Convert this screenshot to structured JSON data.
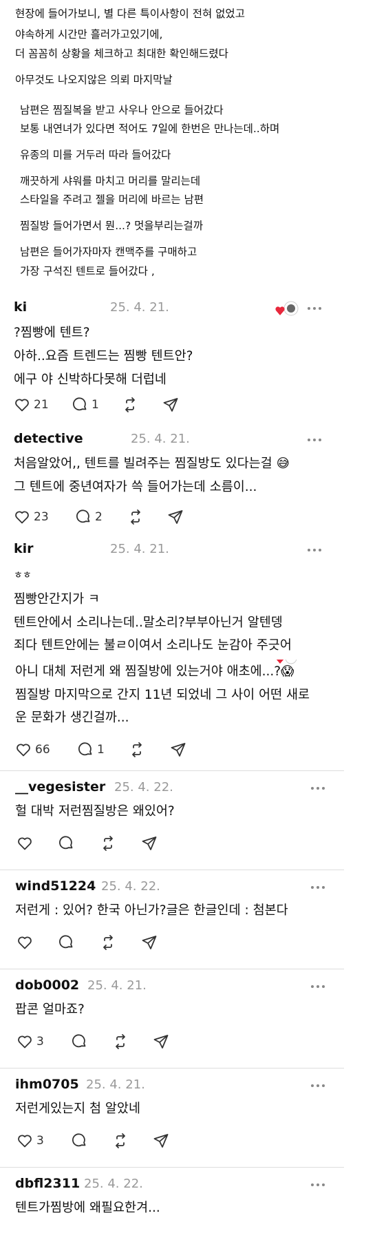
{
  "post": {
    "paragraphs": [
      [
        "현장에 들어가보니, 별 다른 특이사항이 전혀 없었고",
        "야속하게 시간만 흘러가고있기에,",
        "더 꼼꼼히 상황을 체크하고 최대한 확인해드렸다"
      ],
      [
        "아무것도 나오지않은 의뢰 마지막날"
      ],
      [
        "남편은 찜질복을 받고 사우나 안으로 들어갔다",
        "보통 내연녀가 있다면 적어도 7일에 한번은 만나는데..하며"
      ],
      [
        "유종의 미를 거두러 따라 들어갔다"
      ],
      [
        "깨끗하게 샤워를 마치고 머리를 말리는데",
        "스타일을 주려고 젤을 머리에 바르는 남편"
      ],
      [
        "찜질방 들어가면서 뭔...? 멋을부리는걸까"
      ],
      [
        "남편은 들어가자마자 캔맥주를 구매하고",
        "가장 구석진 텐트로 들어갔다 ,"
      ]
    ]
  },
  "replies": [
    {
      "username": "ki",
      "date": "25. 4. 21.",
      "lines": [
        "?찜빵에 텐트?",
        "아하..요즘 트렌드는 찜빵 텐트안?",
        "에구 야 신박하다못해 더럽네"
      ],
      "likes": "21",
      "comments": "1"
    },
    {
      "username": "detective",
      "date": "25. 4. 21.",
      "lines": [
        "처음알았어,, 텐트를 빌려주는 찜질방도 있다는걸 😅",
        "그 텐트에 중년여자가 쓱 들어가는데 소름이..."
      ],
      "likes": "23",
      "comments": "2"
    },
    {
      "username": "kir",
      "date": "25. 4. 21.",
      "lines": [
        "ㅎㅎ",
        "찜빵안간지가 ㅋ",
        "텐트안에서 소리나는데..말소리?부부아닌거 알텐뎅",
        "죄다 텐트안에는 불ㄹ이여서 소리나도 눈감아 주긋어"
      ]
    },
    {
      "lines": [
        "아니 대체 저런게 왜 찜질방에 있는거야 애초에...?😱",
        "찜질방 마지막으로 간지 11년 되었네 그 사이 어떤 새로",
        "운 문화가 생긴걸까..."
      ],
      "likes": "66",
      "comments": "1"
    },
    {
      "username": "__vegesister",
      "date": "25. 4. 22.",
      "lines": [
        "헐 대박 저런찜질방은 왜있어?"
      ]
    },
    {
      "username": "wind51224",
      "date": "25. 4. 22.",
      "lines": [
        "저런게 : 있어? 한국 아닌가?글은 한글인데 : 첨본다"
      ]
    },
    {
      "username": "dob0002",
      "date": "25. 4. 21.",
      "lines": [
        "팝콘 얼마죠?"
      ],
      "likes": "3"
    },
    {
      "username": "ihm0705",
      "date": "25. 4. 21.",
      "lines": [
        "저런게있는지 첨 알았네"
      ],
      "likes": "3"
    },
    {
      "username": "dbfl2311",
      "date": "25. 4. 22.",
      "lines": [
        "텐트가찜방에 왜필요한겨..."
      ]
    }
  ],
  "icons": {
    "like": "heart-icon",
    "comment": "comment-bubble-icon",
    "repost": "repost-icon",
    "share": "send-icon",
    "more": "more-icon",
    "liked_badge": "liked-heart-badge-icon"
  },
  "colors": {
    "username": "#111111",
    "date": "#999999",
    "icon": "#333333",
    "like_red": "#e8283c"
  }
}
